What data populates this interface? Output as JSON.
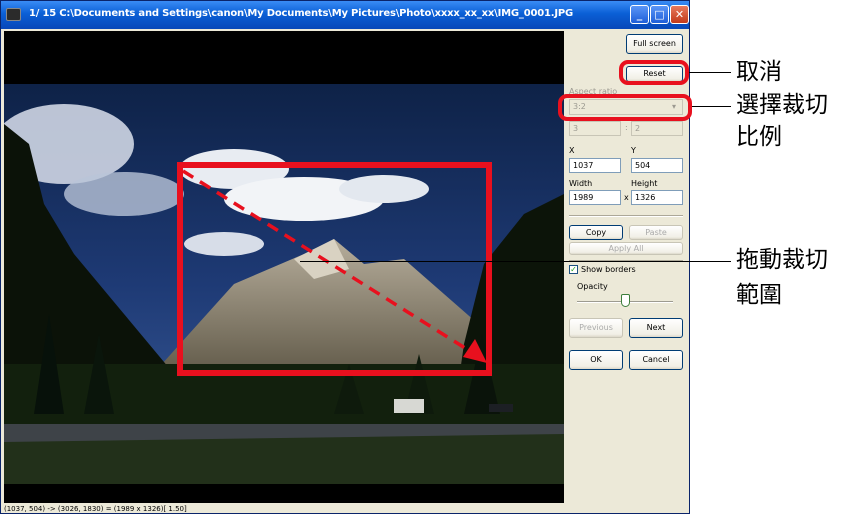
{
  "window": {
    "title": "1/ 15  C:\\Documents and Settings\\canon\\My Documents\\My Pictures\\Photo\\xxxx_xx_xx\\IMG_0001.JPG",
    "title_buttons": {
      "minimize": "_",
      "maximize": "□",
      "close": "✕"
    }
  },
  "panel": {
    "full_screen_label": "Full screen",
    "reset_label": "Reset",
    "aspect_ratio_label": "Aspect ratio",
    "aspect_ratio_value": "3:2",
    "ratio_w": "3",
    "ratio_sep": ":",
    "ratio_h": "2",
    "x_label": "X",
    "y_label": "Y",
    "x_value": "1037",
    "y_value": "504",
    "width_label": "Width",
    "height_label": "Height",
    "width_value": "1989",
    "dim_sep": "x",
    "height_value": "1326",
    "copy_label": "Copy",
    "paste_label": "Paste",
    "apply_all_label": "Apply All",
    "show_borders_label": "Show borders",
    "show_borders_checked": true,
    "opacity_label": "Opacity",
    "opacity_level": 0.5,
    "previous_label": "Previous",
    "next_label": "Next",
    "ok_label": "OK",
    "cancel_label": "Cancel"
  },
  "status_text": "(1037,  504) -> (3026, 1830) = (1989 x 1326)[ 1.50]",
  "annotations": {
    "reset": "取消",
    "aspect_line1": "選擇裁切",
    "aspect_line2": "比例",
    "drag_line1": "拖動裁切",
    "drag_line2": "範圍"
  },
  "colors": {
    "highlight": "#e8101e",
    "titlebar": "#0a5fd6"
  }
}
